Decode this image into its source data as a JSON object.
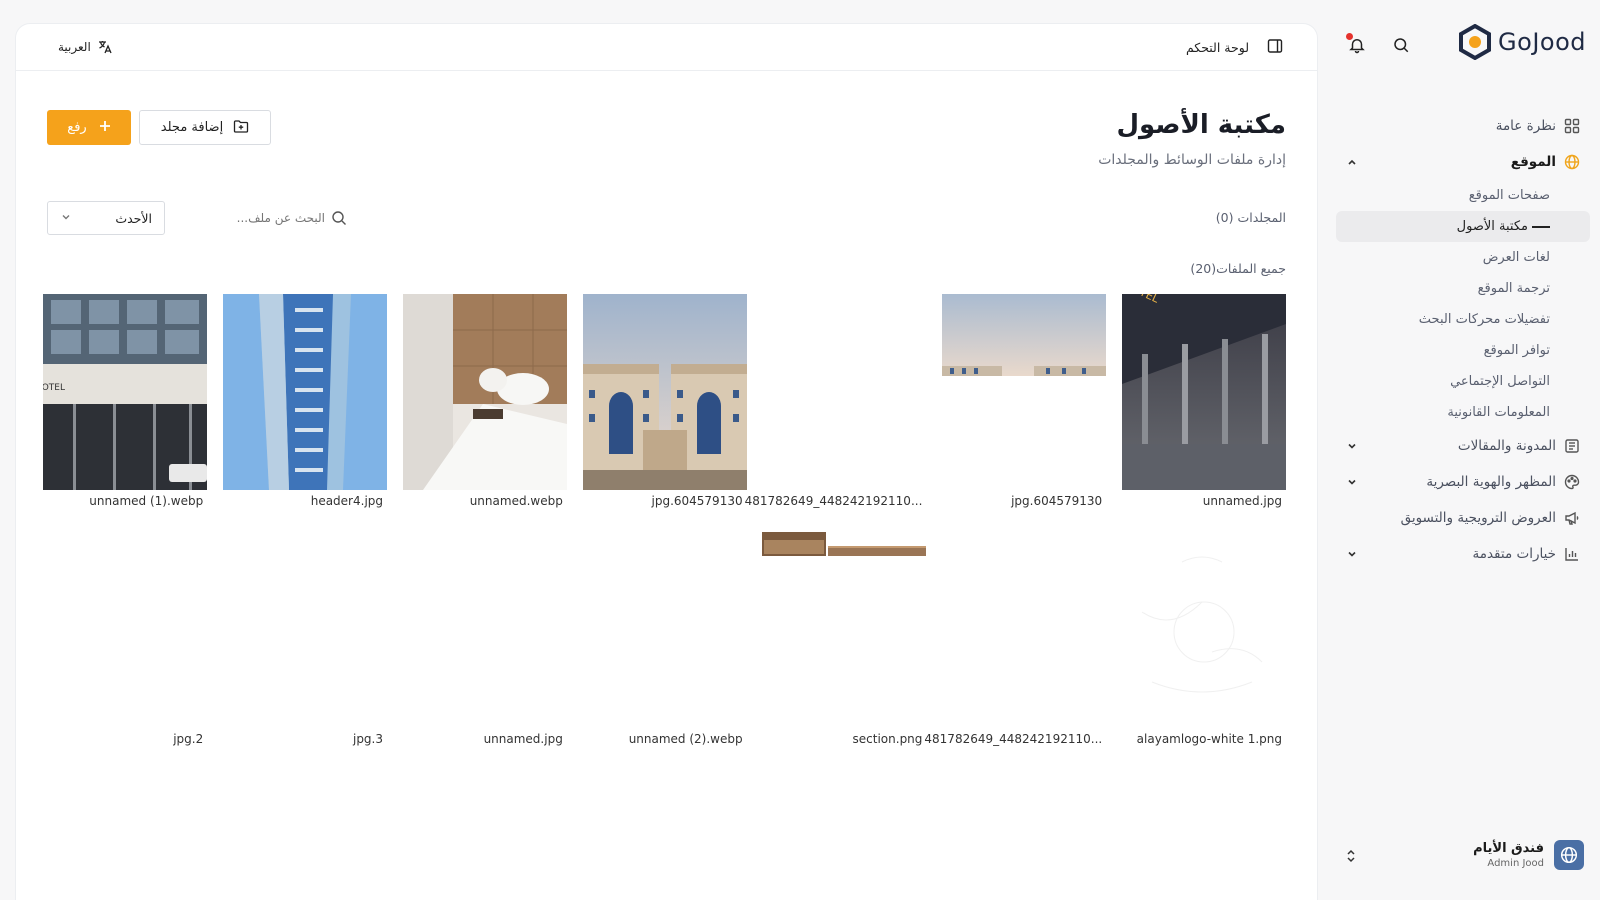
{
  "brand": {
    "name": "GoJood",
    "accent": "#f5a21b",
    "dark": "#1f2a44"
  },
  "sidebar": {
    "items": [
      {
        "label": "نظرة عامة",
        "icon": "grid-icon",
        "expandable": false
      },
      {
        "label": "الموقع",
        "icon": "globe-icon",
        "expandable": true,
        "expanded": true,
        "children": [
          "صفحات الموقع",
          "مكتبة الأصول",
          "لغات العرض",
          "ترجمة الموقع",
          "تفضيلات محركات البحث",
          "توافر الموقع",
          "التواصل الإجتماعي",
          "المعلومات القانونية"
        ]
      },
      {
        "label": "المدونة والمقالات",
        "icon": "newspaper-icon",
        "expandable": true
      },
      {
        "label": "المظهر والهوية البصرية",
        "icon": "palette-icon",
        "expandable": true
      },
      {
        "label": "العروض الترويجية والتسويق",
        "icon": "megaphone-icon",
        "expandable": false
      },
      {
        "label": "خيارات متقدمة",
        "icon": "chart-icon",
        "expandable": true
      }
    ],
    "current": "مكتبة الأصول"
  },
  "account": {
    "org": "فندق الأيام",
    "user": "Admin Jood"
  },
  "topbar": {
    "breadcrumb": "لوحة التحكم",
    "language": "العربية"
  },
  "page": {
    "title": "مكتبة الأصول",
    "subtitle": "إدارة ملفات الوسائط والمجلدات",
    "upload_label": "رفع",
    "add_folder_label": "إضافة مجلد",
    "sort_value": "الأحدث",
    "search_placeholder": "البحث عن ملف...",
    "folders_label": "المجلدات (0)",
    "files_label": "جميع الملفات(20)"
  },
  "files": [
    {
      "name": "unnamed.jpg",
      "thumb": "hotel-night"
    },
    {
      "name": "jpg.604579130",
      "thumb": "hotel-partial"
    },
    {
      "name": "...448242192110_481782649",
      "thumb": "blank"
    },
    {
      "name": "jpg.604579130",
      "thumb": "hotel-twin"
    },
    {
      "name": "unnamed.webp",
      "thumb": "bedroom"
    },
    {
      "name": "header4.jpg",
      "thumb": "tower"
    },
    {
      "name": "unnamed (1).webp",
      "thumb": "hotel-front"
    },
    {
      "name": "alayamlogo-white 1.png",
      "thumb": "logo-white"
    },
    {
      "name": "...448242192110_481782649",
      "thumb": "blank"
    },
    {
      "name": "section.png",
      "thumb": "section-strip"
    },
    {
      "name": "unnamed (2).webp",
      "thumb": "blank"
    },
    {
      "name": "unnamed.jpg",
      "thumb": "blank"
    },
    {
      "name": "jpg.3",
      "thumb": "blank"
    },
    {
      "name": "jpg.2",
      "thumb": "blank"
    }
  ]
}
